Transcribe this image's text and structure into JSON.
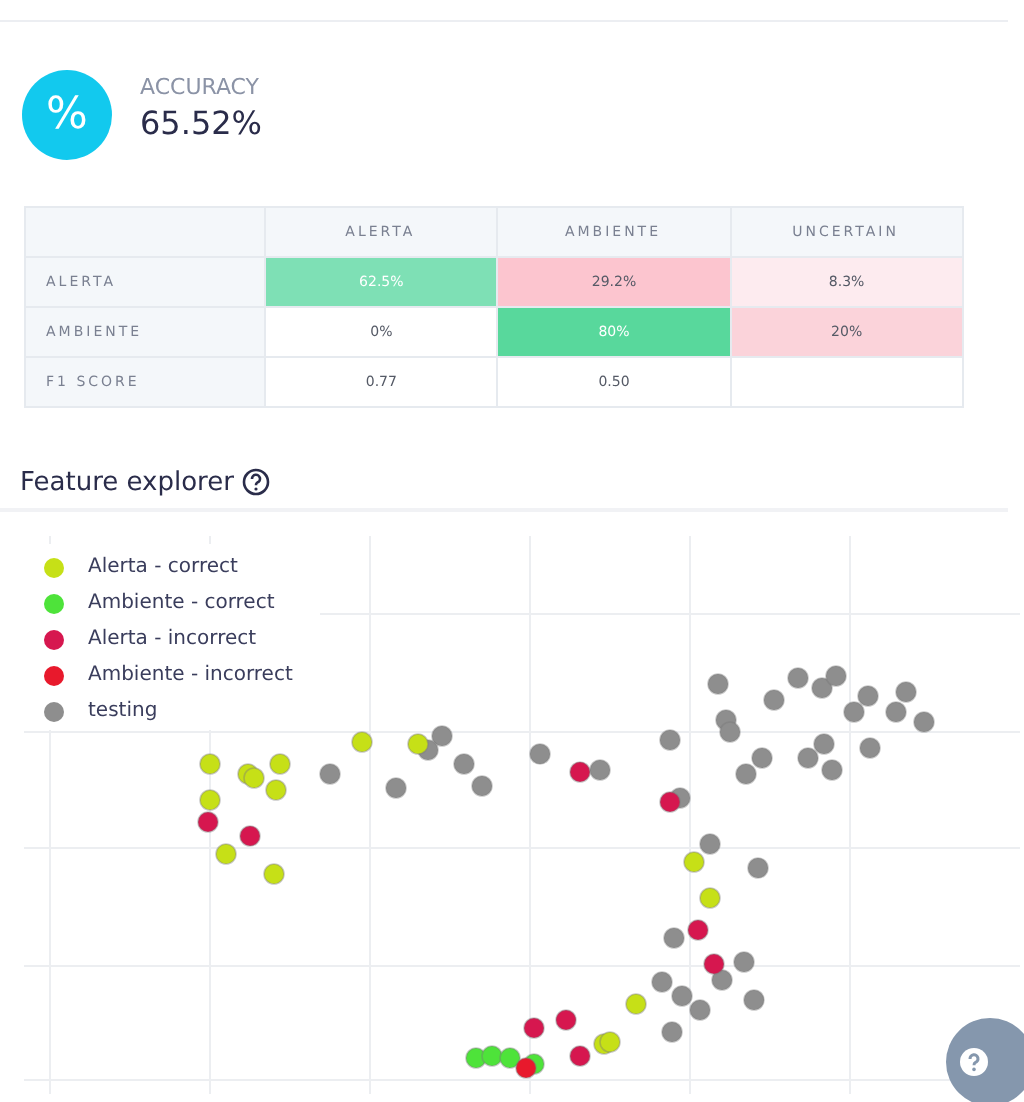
{
  "accuracy": {
    "icon_text": "%",
    "label": "ACCURACY",
    "value": "65.52%"
  },
  "confusion_matrix": {
    "columns": [
      "ALERTA",
      "AMBIENTE",
      "UNCERTAIN"
    ],
    "rows": [
      {
        "label": "ALERTA",
        "cells": [
          {
            "text": "62.5%",
            "color": "#7ee0b5"
          },
          {
            "text": "29.2%",
            "color": "#fcc5cf"
          },
          {
            "text": "8.3%",
            "color": "#fdebef"
          }
        ]
      },
      {
        "label": "AMBIENTE",
        "cells": [
          {
            "text": "0%",
            "color": "#ffffff"
          },
          {
            "text": "80%",
            "color": "#58d89c"
          },
          {
            "text": "20%",
            "color": "#fbd3da"
          }
        ]
      },
      {
        "label": "F1 SCORE",
        "cells": [
          {
            "text": "0.77",
            "color": "#ffffff"
          },
          {
            "text": "0.50",
            "color": "#ffffff"
          }
        ]
      }
    ]
  },
  "feature_explorer": {
    "title": "Feature explorer",
    "legend": [
      {
        "label": "Alerta - correct",
        "color": "#c6e017"
      },
      {
        "label": "Ambiente - correct",
        "color": "#4ee33a"
      },
      {
        "label": "Alerta - incorrect",
        "color": "#d6174f"
      },
      {
        "label": "Ambiente - incorrect",
        "color": "#e8192c"
      },
      {
        "label": "testing",
        "color": "#8e8e8e"
      }
    ]
  }
}
